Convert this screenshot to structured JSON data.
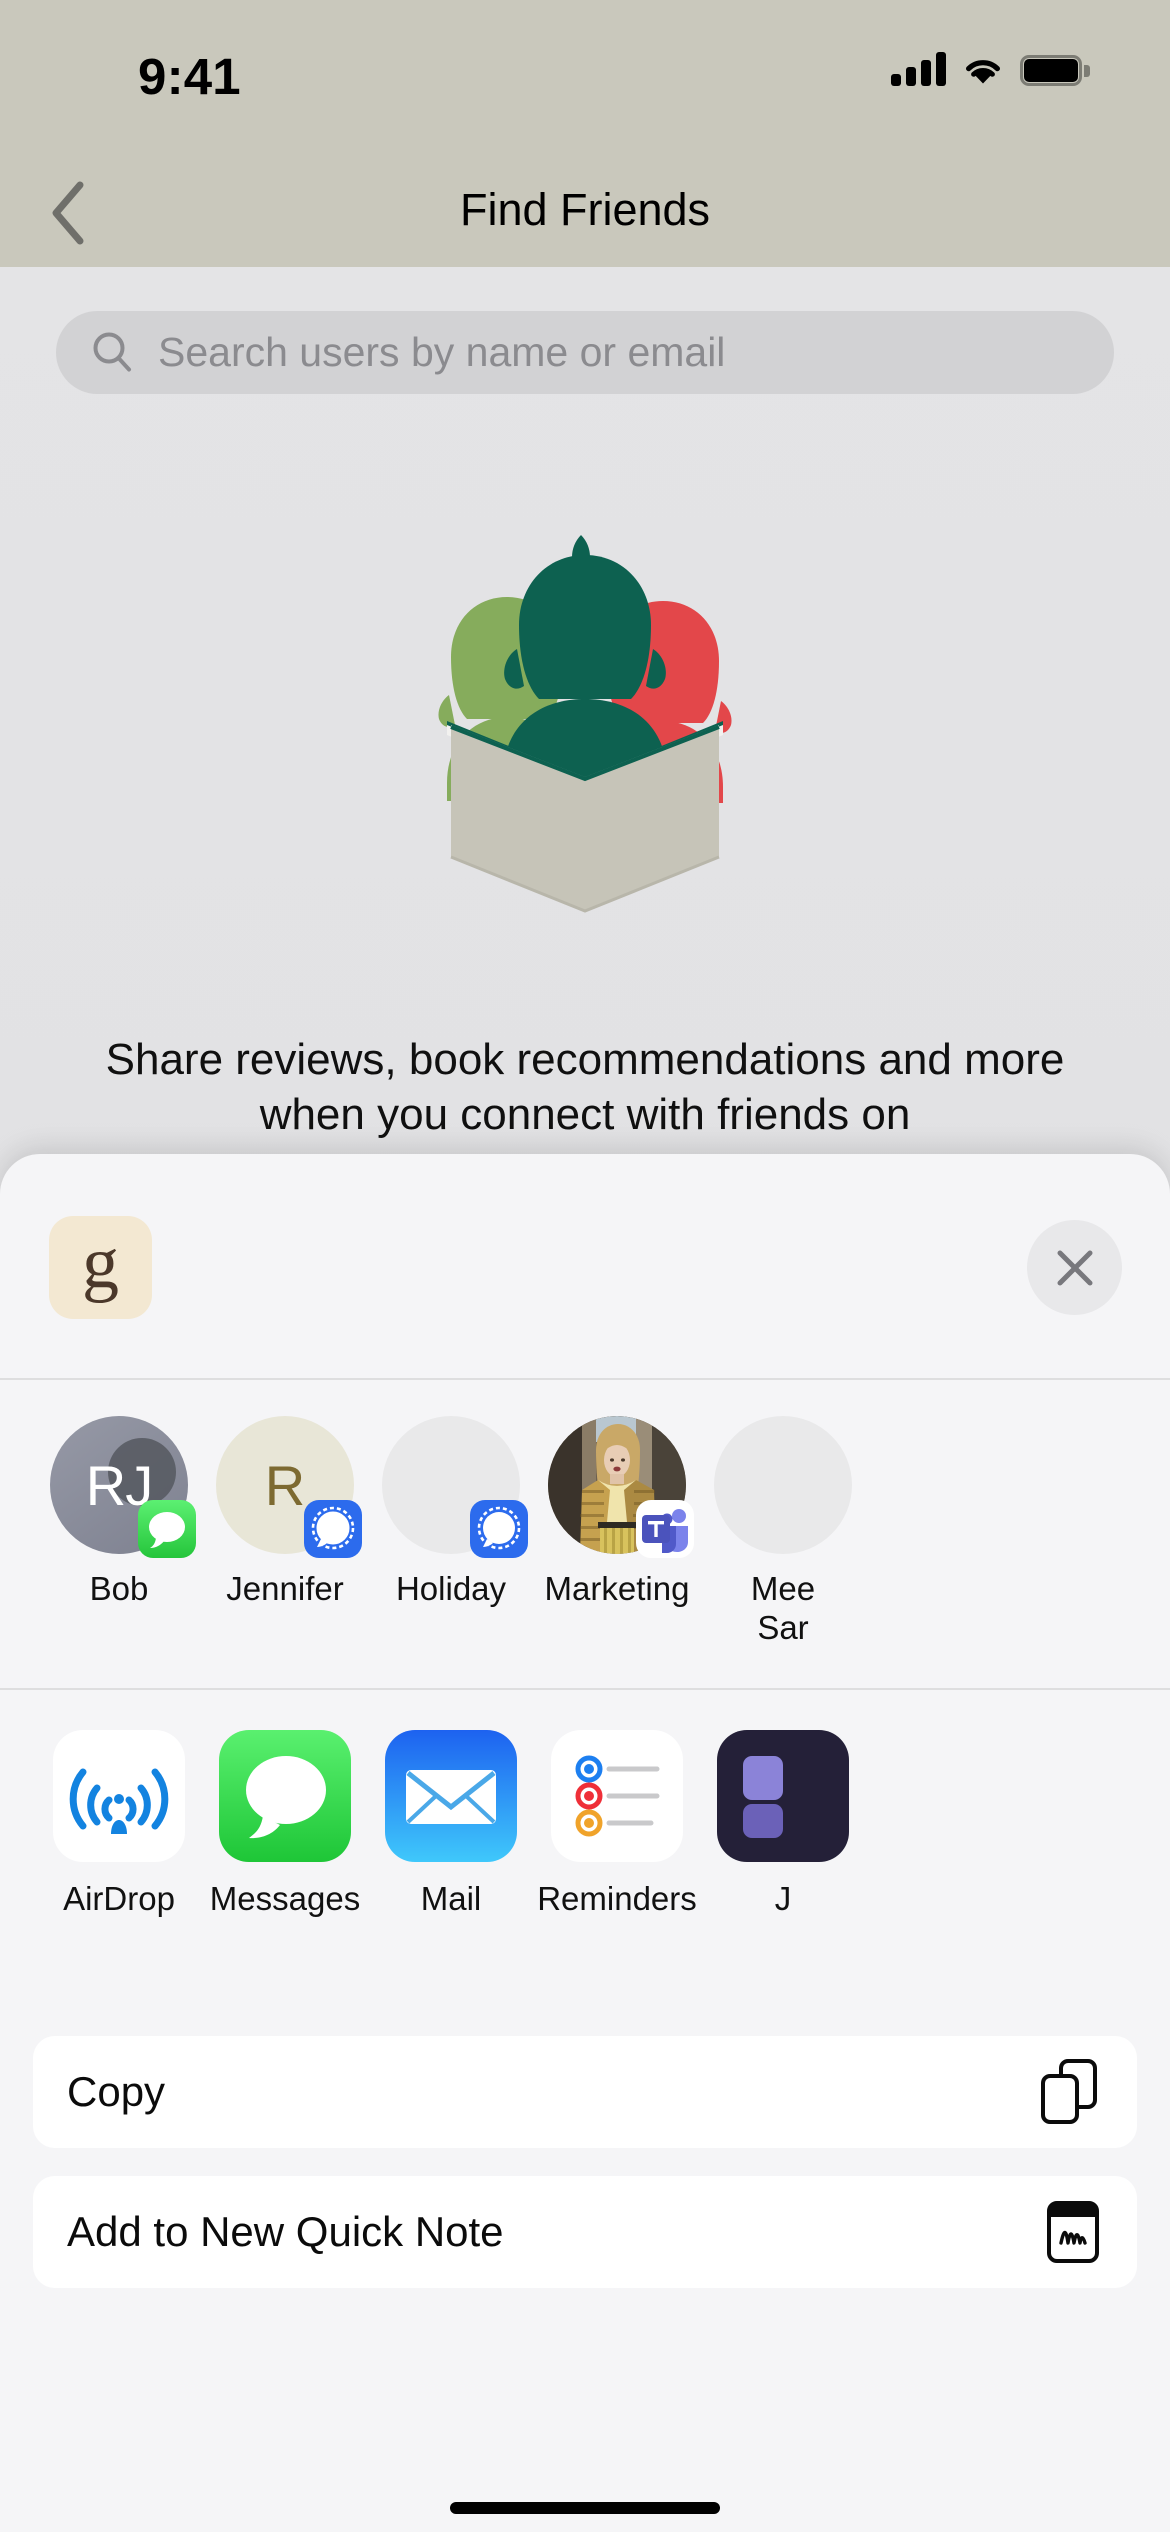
{
  "status_bar": {
    "time": "9:41",
    "cellular_icon": "cellular-signal-icon",
    "wifi_icon": "wifi-icon",
    "battery_icon": "battery-full-icon"
  },
  "nav_bar": {
    "back_icon": "chevron-left-icon",
    "title": "Find Friends"
  },
  "search": {
    "icon": "search-icon",
    "value": "",
    "placeholder": "Search users by name or email"
  },
  "empty_state": {
    "illustration": "three-people-reading-book-illustration",
    "message": "Share reviews, book recommendations and more when you connect with friends on",
    "colors": {
      "green_dark": "#0d6150",
      "green_light": "#86ac5c",
      "red": "#e3474a",
      "book": "#c6c4b8"
    }
  },
  "share_sheet": {
    "app_icon_letter": "g",
    "app_icon_bg": "#f3e8d2",
    "app_icon_fg": "#4b382a",
    "close_icon": "close-icon",
    "contacts": [
      {
        "name": "Bob",
        "avatar_type": "monogram",
        "initials": "RJ",
        "avatar_bg": "#8b8e9c",
        "avatar_fg": "#ffffff",
        "badge_app": "messages-badge-icon",
        "badge_bg": "#36d94a"
      },
      {
        "name": "Jennifer",
        "avatar_type": "monogram",
        "initials": "R",
        "avatar_bg": "#e8e6d7",
        "avatar_fg": "#7d6a31",
        "badge_app": "signal-badge-icon",
        "badge_bg": "#2c6bed"
      },
      {
        "name": "Holiday",
        "avatar_type": "blank",
        "initials": "",
        "avatar_bg": "#e9e9ea",
        "avatar_fg": "#b4b4b6",
        "badge_app": "signal-badge-icon",
        "badge_bg": "#2c6bed"
      },
      {
        "name": "Marketing",
        "avatar_type": "photo",
        "initials": "",
        "avatar_bg": "#6a5a46",
        "avatar_fg": "#ffffff",
        "badge_app": "microsoft-teams-badge-icon",
        "badge_bg": "#ffffff"
      },
      {
        "name": "Mee\nSar",
        "avatar_type": "blank",
        "initials": "",
        "avatar_bg": "#e9e9ea",
        "avatar_fg": "#b4b4b6",
        "badge_app": "",
        "badge_bg": "transparent"
      }
    ],
    "apps": [
      {
        "name": "AirDrop",
        "icon": "airdrop-icon"
      },
      {
        "name": "Messages",
        "icon": "messages-icon"
      },
      {
        "name": "Mail",
        "icon": "mail-icon"
      },
      {
        "name": "Reminders",
        "icon": "reminders-icon"
      },
      {
        "name": "J",
        "icon": "jira-icon"
      }
    ],
    "actions": [
      {
        "label": "Copy",
        "icon": "copy-doc-on-doc-icon"
      },
      {
        "label": "Add to New Quick Note",
        "icon": "quick-note-icon"
      }
    ]
  },
  "home_indicator": "home-indicator"
}
